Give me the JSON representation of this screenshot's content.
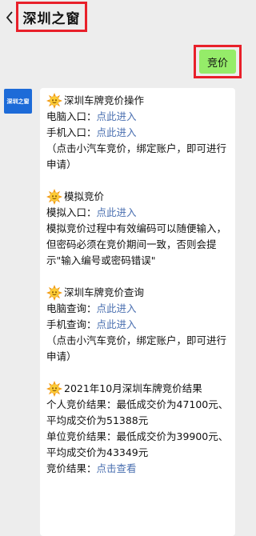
{
  "header": {
    "title": "深圳之窗"
  },
  "sent_message": {
    "text": "竞价"
  },
  "avatar": {
    "label": "深圳之窗"
  },
  "sections": [
    {
      "title": "深圳车牌竞价操作",
      "lines": [
        {
          "prefix": "电脑入口：",
          "link": "点此进入"
        },
        {
          "prefix": "手机入口：",
          "link": "点此进入"
        }
      ],
      "note": "（点击小汽车竞价，绑定账户，即可进行申请）"
    },
    {
      "title": "模拟竞价",
      "lines": [
        {
          "prefix": "模拟入口：",
          "link": "点此进入"
        }
      ],
      "note": "模拟竞价过程中有效编码可以随便输入，但密码必须在竞价期间一致，否则会提示\"输入编号或密码错误\""
    },
    {
      "title": "深圳车牌竞价查询",
      "lines": [
        {
          "prefix": "电脑查询：",
          "link": "点此进入"
        },
        {
          "prefix": "手机查询：",
          "link": "点此进入"
        }
      ],
      "note": "（点击小汽车竞价，绑定账户，即可进行申请）"
    },
    {
      "title": "2021年10月深圳车牌竞价结果",
      "texts": [
        "个人竞价结果：最低成交价为47100元、平均成交价为51388元",
        "单位竞价结果：最低成交价为39900元、平均成交价为43349元"
      ],
      "lines": [
        {
          "prefix": "竞价结果：",
          "link": "点击查看"
        }
      ]
    }
  ]
}
